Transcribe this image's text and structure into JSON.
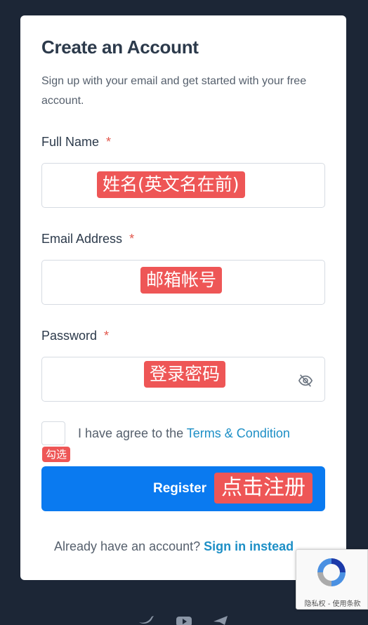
{
  "form": {
    "title": "Create an Account",
    "subtitle": "Sign up with your email and get started with your free account.",
    "full_name": {
      "label": "Full Name",
      "required_mark": "*",
      "annotation": "姓名(英文名在前)"
    },
    "email": {
      "label": "Email Address",
      "required_mark": "*",
      "annotation": "邮箱帐号"
    },
    "password": {
      "label": "Password",
      "required_mark": "*",
      "annotation": "登录密码",
      "toggle_icon": "eye-off-icon"
    },
    "agree": {
      "prefix": "I have agree to the ",
      "link": "Terms & Condition",
      "annotation": "勾选"
    },
    "register": {
      "label": "Register",
      "annotation": "点击注册"
    },
    "signin": {
      "prompt": "Already have an account? ",
      "link": "Sign in instead"
    }
  },
  "recaptcha": {
    "text": "隐私权 - 使用条款"
  },
  "footer": {
    "icons": [
      "twitter-icon",
      "youtube-icon",
      "telegram-icon"
    ]
  },
  "colors": {
    "background": "#1c2636",
    "primary": "#0a7af0",
    "link": "#1d8fc6",
    "required": "#e2574c",
    "annotation": "#ee5656"
  }
}
